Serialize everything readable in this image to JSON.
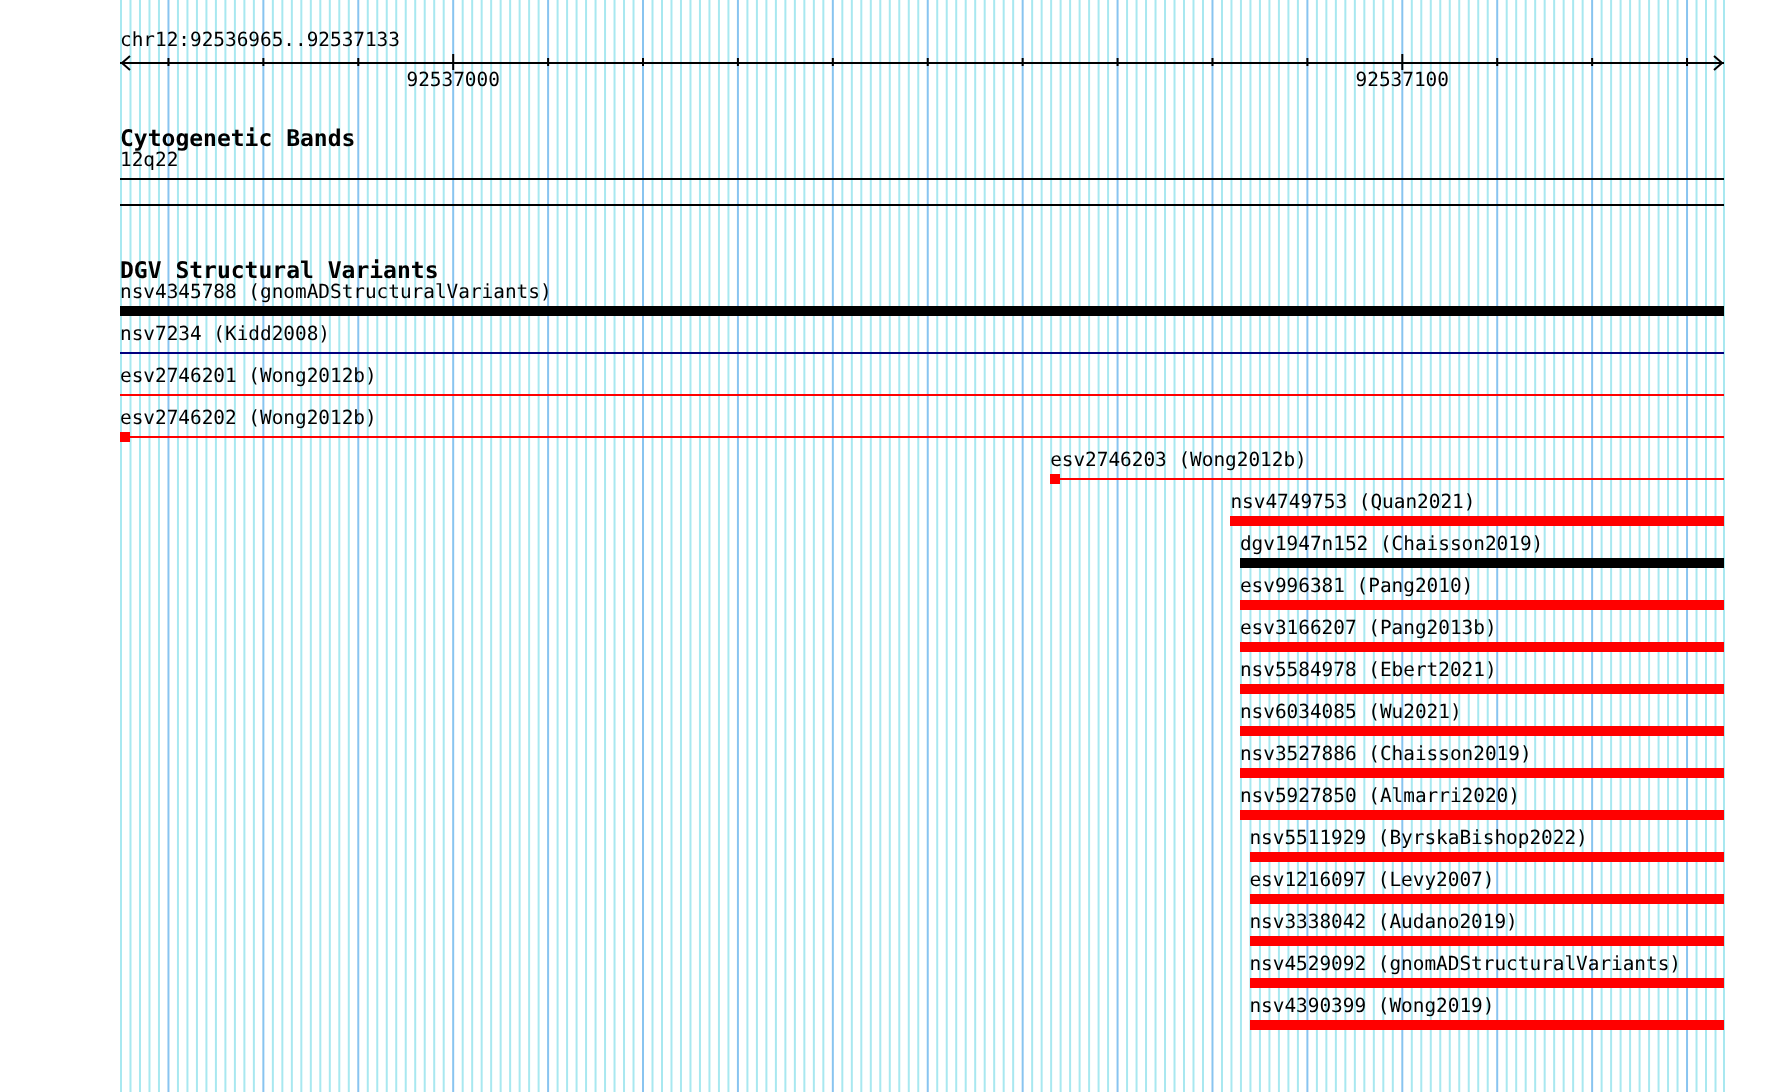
{
  "ruler": {
    "location": "chr12:92536965..92537133",
    "labels": [
      "92537000",
      "92537100"
    ]
  },
  "tracks": [
    {
      "title": "Cytogenetic Bands",
      "features": [
        {
          "label": "12q22",
          "kind": "line",
          "color": "#000000"
        }
      ]
    },
    {
      "title": "DGV Structural Variants",
      "features": [
        {
          "label": "nsv4345788 (gnomADStructuralVariants)",
          "kind": "bar",
          "color": "#000000"
        },
        {
          "label": "nsv7234 (Kidd2008)",
          "kind": "line",
          "color": "#000080"
        },
        {
          "label": "esv2746201 (Wong2012b)",
          "kind": "line",
          "color": "#ff0000"
        },
        {
          "label": "esv2746202 (Wong2012b)",
          "kind": "block-line",
          "color": "#ff0000"
        },
        {
          "label": "esv2746203 (Wong2012b)",
          "kind": "block-line",
          "color": "#ff0000"
        },
        {
          "label": "nsv4749753 (Quan2021)",
          "kind": "bar",
          "color": "#ff0000"
        },
        {
          "label": "dgv1947n152 (Chaisson2019)",
          "kind": "bar",
          "color": "#000000"
        },
        {
          "label": "esv996381 (Pang2010)",
          "kind": "bar",
          "color": "#ff0000"
        },
        {
          "label": "esv3166207 (Pang2013b)",
          "kind": "bar",
          "color": "#ff0000"
        },
        {
          "label": "nsv5584978 (Ebert2021)",
          "kind": "bar",
          "color": "#ff0000"
        },
        {
          "label": "nsv6034085 (Wu2021)",
          "kind": "bar",
          "color": "#ff0000"
        },
        {
          "label": "nsv3527886 (Chaisson2019)",
          "kind": "bar",
          "color": "#ff0000"
        },
        {
          "label": "nsv5927850 (Almarri2020)",
          "kind": "bar",
          "color": "#ff0000"
        },
        {
          "label": "nsv5511929 (ByrskaBishop2022)",
          "kind": "bar",
          "color": "#ff0000"
        },
        {
          "label": "esv1216097 (Levy2007)",
          "kind": "bar",
          "color": "#ff0000"
        },
        {
          "label": "nsv3338042 (Audano2019)",
          "kind": "bar",
          "color": "#ff0000"
        },
        {
          "label": "nsv4529092 (gnomADStructuralVariants)",
          "kind": "bar",
          "color": "#ff0000"
        },
        {
          "label": "nsv4390399 (Wong2019)",
          "kind": "bar",
          "color": "#ff0000"
        }
      ]
    }
  ]
}
